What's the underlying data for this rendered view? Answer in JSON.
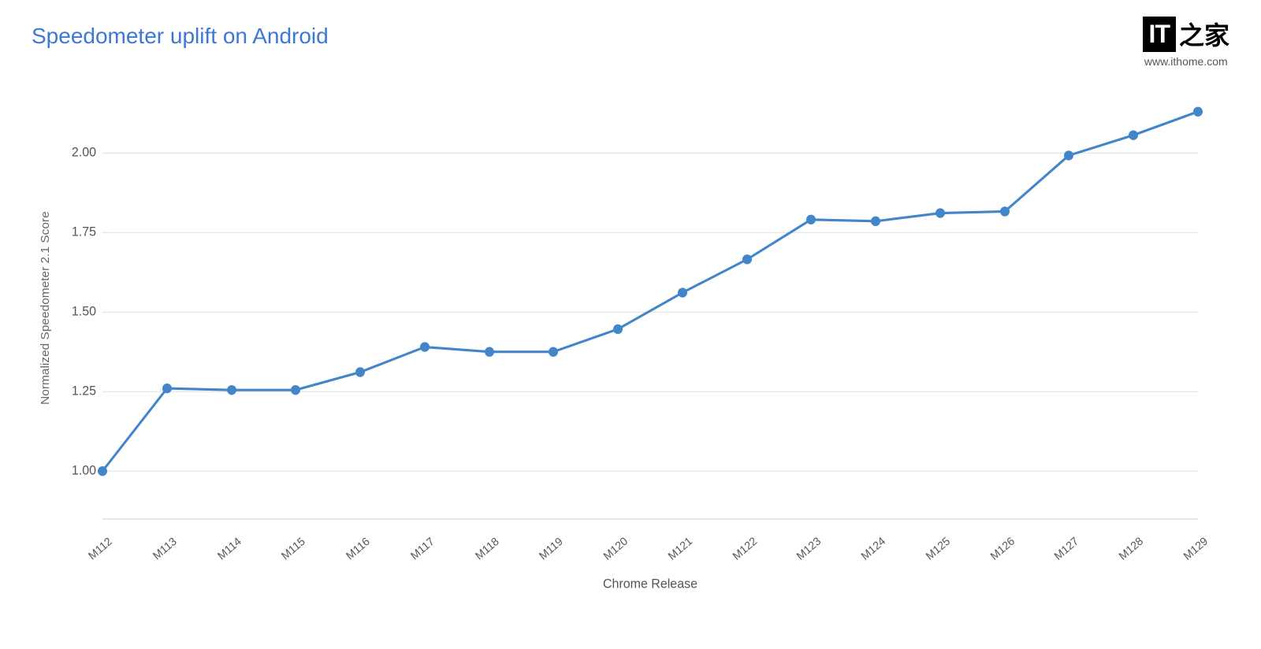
{
  "title": "Speedometer uplift on Android",
  "logo": {
    "it_label": "IT",
    "chinese_text": "之家",
    "url": "www.ithome.com"
  },
  "chart": {
    "x_axis_label": "Chrome Release",
    "y_axis_label": "Normalized Speedometer 2.1 Score",
    "x_labels": [
      "M112",
      "M113",
      "M114",
      "M115",
      "M116",
      "M117",
      "M118",
      "M119",
      "M120",
      "M121",
      "M122",
      "M123",
      "M124",
      "M125",
      "M126",
      "M127",
      "M128",
      "M129"
    ],
    "y_labels": [
      "1.00",
      "1.25",
      "1.50",
      "1.75",
      "2.00"
    ],
    "data_points": [
      {
        "x": "M112",
        "y": 1.0
      },
      {
        "x": "M113",
        "y": 1.26
      },
      {
        "x": "M114",
        "y": 1.255
      },
      {
        "x": "M115",
        "y": 1.255
      },
      {
        "x": "M116",
        "y": 1.31
      },
      {
        "x": "M117",
        "y": 1.39
      },
      {
        "x": "M118",
        "y": 1.375
      },
      {
        "x": "M119",
        "y": 1.375
      },
      {
        "x": "M120",
        "y": 1.445
      },
      {
        "x": "M121",
        "y": 1.56
      },
      {
        "x": "M122",
        "y": 1.665
      },
      {
        "x": "M123",
        "y": 1.79
      },
      {
        "x": "M124",
        "y": 1.785
      },
      {
        "x": "M125",
        "y": 1.81
      },
      {
        "x": "M126",
        "y": 1.815
      },
      {
        "x": "M127",
        "y": 1.99
      },
      {
        "x": "M128",
        "y": 2.055
      },
      {
        "x": "M129",
        "y": 2.13
      }
    ],
    "line_color": "#4285c8",
    "dot_color": "#4285c8",
    "grid_color": "#e0e0e0",
    "axis_color": "#cccccc",
    "y_min": 0.85,
    "y_max": 2.2
  }
}
